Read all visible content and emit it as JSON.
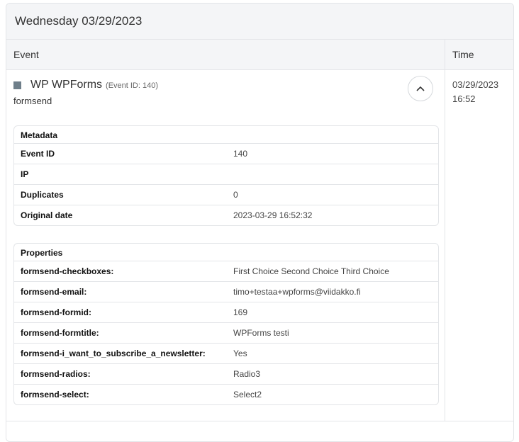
{
  "day_title": "Wednesday 03/29/2023",
  "columns": {
    "event": "Event",
    "time": "Time"
  },
  "event": {
    "name": "WP WPForms",
    "event_id_label": "(Event ID: 140)",
    "type": "formsend",
    "time_date": "03/29/2023",
    "time_clock": "16:52",
    "metadata": {
      "title": "Metadata",
      "rows": [
        {
          "k": "Event ID",
          "v": "140"
        },
        {
          "k": "IP",
          "v": ""
        },
        {
          "k": "Duplicates",
          "v": "0"
        },
        {
          "k": "Original date",
          "v": "2023-03-29 16:52:32"
        }
      ]
    },
    "properties": {
      "title": "Properties",
      "rows": [
        {
          "k": "formsend-checkboxes:",
          "v": "First Choice Second Choice Third Choice"
        },
        {
          "k": "formsend-email:",
          "v": "timo+testaa+wpforms@viidakko.fi"
        },
        {
          "k": "formsend-formid:",
          "v": "169"
        },
        {
          "k": "formsend-formtitle:",
          "v": "WPForms testi"
        },
        {
          "k": "formsend-i_want_to_subscribe_a_newsletter:",
          "v": "Yes"
        },
        {
          "k": "formsend-radios:",
          "v": "Radio3"
        },
        {
          "k": "formsend-select:",
          "v": "Select2"
        }
      ]
    }
  },
  "colors": {
    "marker": "#6f7f8a",
    "header_bg": "#f4f5f7"
  }
}
